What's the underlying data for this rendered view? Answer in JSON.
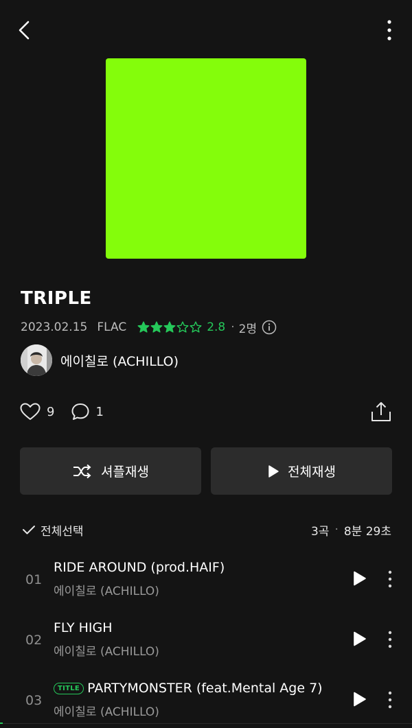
{
  "album": {
    "cover_color": "#84fd0b",
    "title": "TRIPLE",
    "release_date": "2023.02.15",
    "format": "FLAC",
    "rating": 2.8,
    "rating_text": "2.8",
    "raters_text": "2명",
    "rating_color": "#25c85a"
  },
  "artist": {
    "name": "에이칠로 (ACHILLO)"
  },
  "social": {
    "likes": "9",
    "comments": "1"
  },
  "actions": {
    "shuffle_label": "셔플재생",
    "play_all_label": "전체재생"
  },
  "tracklist": {
    "select_all_label": "전체선택",
    "track_count": "3곡",
    "duration": "8분 29초",
    "tracks": [
      {
        "num": "01",
        "title": "RIDE AROUND (prod.HAIF)",
        "artist": "에이칠로 (ACHILLO)",
        "is_title": false
      },
      {
        "num": "02",
        "title": "FLY HIGH",
        "artist": "에이칠로 (ACHILLO)",
        "is_title": false
      },
      {
        "num": "03",
        "badge": "TITLE",
        "title": "PARTYMONSTER (feat.Mental Age 7)",
        "artist": "에이칠로 (ACHILLO)",
        "is_title": true
      }
    ]
  },
  "icons": {
    "back": "chevron-left-icon",
    "more": "more-vertical-icon",
    "info": "info-icon",
    "like": "heart-icon",
    "comment": "comment-icon",
    "share": "share-icon",
    "shuffle": "shuffle-icon",
    "play": "play-icon",
    "check": "check-icon"
  }
}
